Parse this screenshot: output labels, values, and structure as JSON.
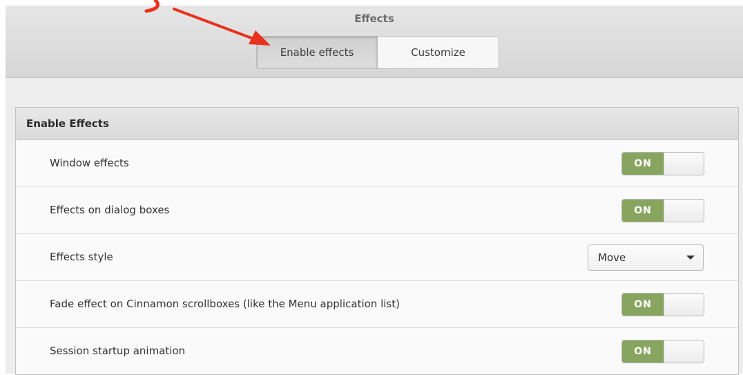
{
  "header": {
    "title": "Effects",
    "tabs": [
      {
        "label": "Enable effects",
        "active": true
      },
      {
        "label": "Customize",
        "active": false
      }
    ]
  },
  "section": {
    "title": "Enable Effects",
    "rows": [
      {
        "label": "Window effects",
        "control": "toggle",
        "value": "ON"
      },
      {
        "label": "Effects on dialog boxes",
        "control": "toggle",
        "value": "ON"
      },
      {
        "label": "Effects style",
        "control": "combo",
        "value": "Move"
      },
      {
        "label": "Fade effect on Cinnamon scrollboxes (like the Menu application list)",
        "control": "toggle",
        "value": "ON"
      },
      {
        "label": "Session startup animation",
        "control": "toggle",
        "value": "ON"
      }
    ]
  },
  "colors": {
    "toggle_on": "#87a55f",
    "annotation_arrow": "#e8321e"
  }
}
